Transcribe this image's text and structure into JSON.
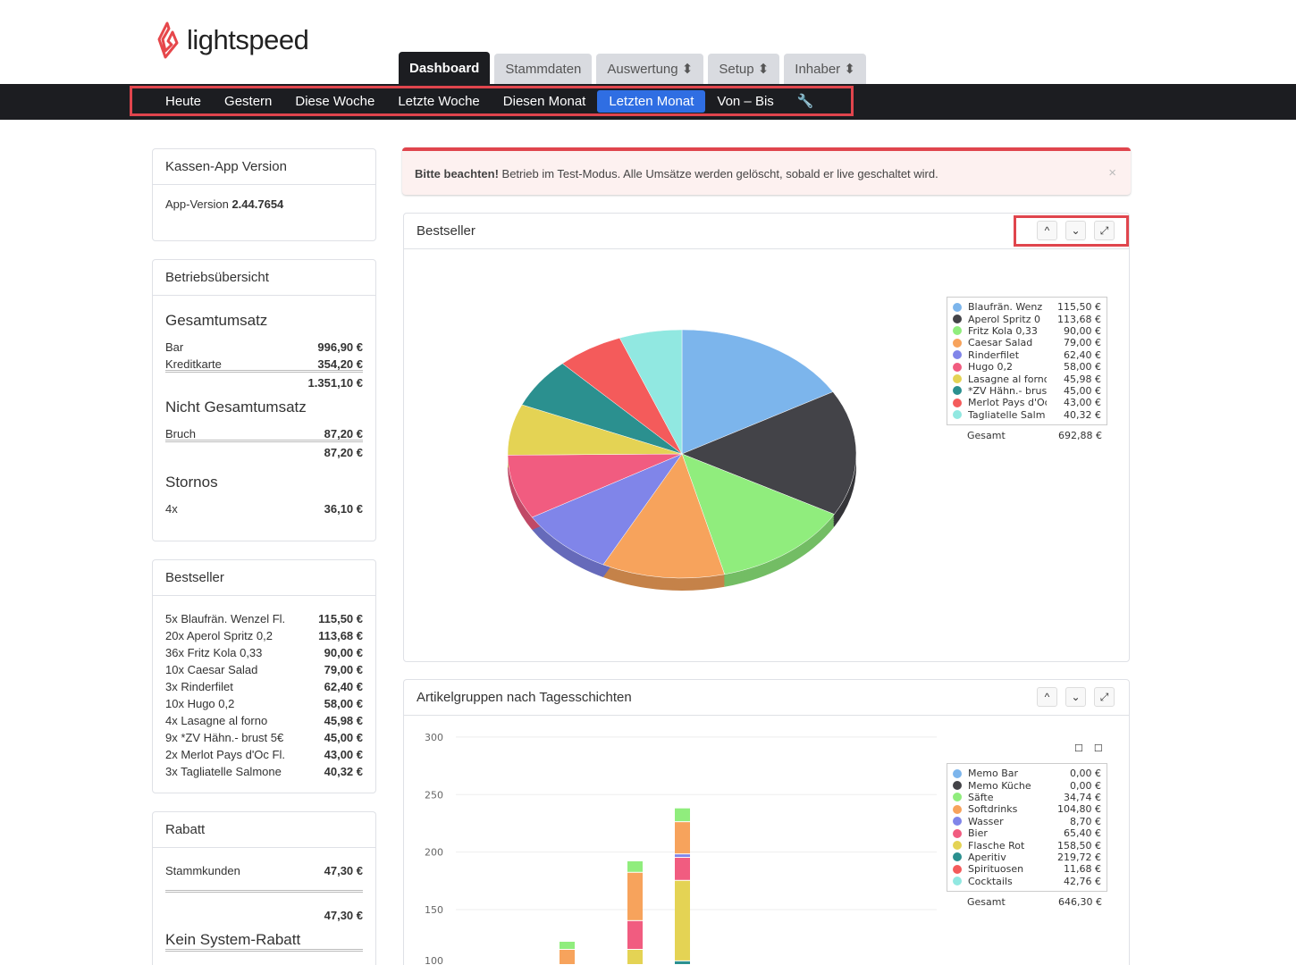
{
  "brand": {
    "name": "lightspeed"
  },
  "tabs": [
    {
      "label": "Dashboard"
    },
    {
      "label": "Stammdaten"
    },
    {
      "label": "Auswertung ⬍"
    },
    {
      "label": "Setup ⬍"
    },
    {
      "label": "Inhaber ⬍"
    }
  ],
  "ranges": [
    "Heute",
    "Gestern",
    "Diese Woche",
    "Letzte Woche",
    "Diesen Monat",
    "Letzten Monat",
    "Von – Bis"
  ],
  "version": {
    "title": "Kassen-App Version",
    "label": "App-Version",
    "value": "2.44.7654"
  },
  "overview": {
    "title": "Betriebsübersicht",
    "gesamt_title": "Gesamtumsatz",
    "bar_label": "Bar",
    "bar": "996,90 €",
    "kk_label": "Kreditkarte",
    "kk": "354,20 €",
    "gesamt": "1.351,10 €",
    "nicht_title": "Nicht Gesamtumsatz",
    "bruch_label": "Bruch",
    "bruch": "87,20 €",
    "nicht_total": "87,20 €",
    "storno_title": "Stornos",
    "storno_count": "4x",
    "storno": "36,10 €"
  },
  "bestseller_list": {
    "title": "Bestseller",
    "items": [
      {
        "name": "5x Blaufrän. Wenzel Fl.",
        "value": "115,50 €"
      },
      {
        "name": "20x Aperol Spritz 0,2",
        "value": "113,68 €"
      },
      {
        "name": "36x Fritz Kola 0,33",
        "value": "90,00 €"
      },
      {
        "name": "10x Caesar Salad",
        "value": "79,00 €"
      },
      {
        "name": "3x Rinderfilet",
        "value": "62,40 €"
      },
      {
        "name": "10x Hugo 0,2",
        "value": "58,00 €"
      },
      {
        "name": "4x Lasagne al forno",
        "value": "45,98 €"
      },
      {
        "name": "9x *ZV Hähn.- brust 5€",
        "value": "45,00 €"
      },
      {
        "name": "2x Merlot Pays d'Oc Fl.",
        "value": "43,00 €"
      },
      {
        "name": "3x Tagliatelle Salmone",
        "value": "40,32 €"
      }
    ]
  },
  "rabatt": {
    "title": "Rabatt",
    "stamm_label": "Stammkunden",
    "stamm": "47,30 €",
    "total": "47,30 €",
    "kein_title": "Kein System-Rabatt"
  },
  "alert": {
    "strong": "Bitte beachten!",
    "text": " Betrieb im Test-Modus. Alle Umsätze werden gelöscht, sobald er live geschaltet wird.",
    "close": "×"
  },
  "panel1": {
    "title": "Bestseller",
    "up": "^",
    "down": "⌄",
    "expand": "⤢"
  },
  "panel2": {
    "title": "Artikelgruppen nach Tagesschichten",
    "up": "^",
    "down": "⌄",
    "expand": "⤢"
  },
  "chart_data": [
    {
      "type": "pie",
      "title": "Bestseller",
      "total_label": "Gesamt",
      "total": "692,88 €",
      "slices": [
        {
          "name": "Blaufrän. Wenz",
          "label": "115,50 €",
          "value": 115.5,
          "color": "#7cb5ec"
        },
        {
          "name": "Aperol Spritz 0",
          "label": "113,68 €",
          "value": 113.68,
          "color": "#434348"
        },
        {
          "name": "Fritz Kola 0,33",
          "label": "90,00 €",
          "value": 90,
          "color": "#90ed7d"
        },
        {
          "name": "Caesar Salad",
          "label": "79,00 €",
          "value": 79,
          "color": "#f7a35c"
        },
        {
          "name": "Rinderfilet",
          "label": "62,40 €",
          "value": 62.4,
          "color": "#8085e9"
        },
        {
          "name": "Hugo 0,2",
          "label": "58,00 €",
          "value": 58,
          "color": "#f15c80"
        },
        {
          "name": "Lasagne al forno",
          "label": "45,98 €",
          "value": 45.98,
          "color": "#e4d354"
        },
        {
          "name": "*ZV Hähn.- brus",
          "label": "45,00 €",
          "value": 45,
          "color": "#2b908f"
        },
        {
          "name": "Merlot Pays d'Oc",
          "label": "43,00 €",
          "value": 43,
          "color": "#f45b5b"
        },
        {
          "name": "Tagliatelle Salm",
          "label": "40,32 €",
          "value": 40.32,
          "color": "#91e8e1"
        }
      ]
    },
    {
      "type": "bar",
      "stacked": true,
      "title": "Artikelgruppen nach Tagesschichten",
      "yticks": [
        "300",
        "250",
        "200",
        "150",
        "100"
      ],
      "ylim": [
        0,
        300
      ],
      "total_label": "Gesamt",
      "total": "646,30 €",
      "legend": [
        {
          "name": "Memo Bar",
          "label": "0,00 €",
          "color": "#7cb5ec"
        },
        {
          "name": "Memo Küche",
          "label": "0,00 €",
          "color": "#434348"
        },
        {
          "name": "Säfte",
          "label": "34,74 €",
          "color": "#90ed7d"
        },
        {
          "name": "Softdrinks",
          "label": "104,80 €",
          "color": "#f7a35c"
        },
        {
          "name": "Wasser",
          "label": "8,70 €",
          "color": "#8085e9"
        },
        {
          "name": "Bier",
          "label": "65,40 €",
          "color": "#f15c80"
        },
        {
          "name": "Flasche Rot",
          "label": "158,50 €",
          "color": "#e4d354"
        },
        {
          "name": "Aperitiv",
          "label": "219,72 €",
          "color": "#2b908f"
        },
        {
          "name": "Spirituosen",
          "label": "11,68 €",
          "color": "#f45b5b"
        },
        {
          "name": "Cocktails",
          "label": "42,76 €",
          "color": "#91e8e1"
        }
      ],
      "bars": [
        {
          "slot": 3,
          "segments": [
            {
              "series": "Aperitiv",
              "value": 60
            },
            {
              "series": "Softdrinks",
              "value": 55
            },
            {
              "series": "Säfte",
              "value": 7
            }
          ]
        },
        {
          "slot": 5,
          "segments": [
            {
              "series": "Aperitiv",
              "value": 70
            },
            {
              "series": "Flasche Rot",
              "value": 45
            },
            {
              "series": "Bier",
              "value": 25
            },
            {
              "series": "Softdrinks",
              "value": 42
            },
            {
              "series": "Säfte",
              "value": 10
            }
          ]
        },
        {
          "slot": 6,
          "segments": [
            {
              "series": "Aperitiv",
              "value": 105
            },
            {
              "series": "Flasche Rot",
              "value": 70
            },
            {
              "series": "Bier",
              "value": 20
            },
            {
              "series": "Wasser",
              "value": 3
            },
            {
              "series": "Softdrinks",
              "value": 28
            },
            {
              "series": "Säfte",
              "value": 12
            }
          ]
        }
      ]
    }
  ]
}
